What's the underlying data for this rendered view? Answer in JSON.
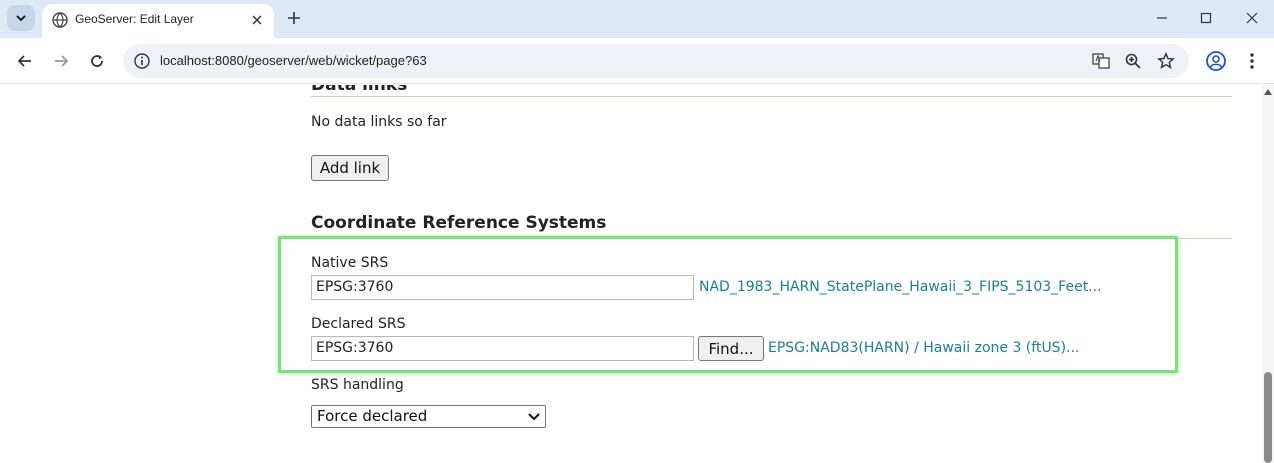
{
  "browser": {
    "tab_title": "GeoServer: Edit Layer",
    "url": "localhost:8080/geoserver/web/wicket/page?63"
  },
  "data_links": {
    "heading": "Data links",
    "empty_text": "No data links so far",
    "add_button": "Add link"
  },
  "crs": {
    "heading": "Coordinate Reference Systems",
    "native_label": "Native SRS",
    "native_value": "EPSG:3760",
    "native_link": "NAD_1983_HARN_StatePlane_Hawaii_3_FIPS_5103_Feet...",
    "declared_label": "Declared SRS",
    "declared_value": "EPSG:3760",
    "find_button": "Find...",
    "declared_link": "EPSG:NAD83(HARN) / Hawaii zone 3 (ftUS)...",
    "handling_label": "SRS handling",
    "handling_value": "Force declared"
  },
  "colors": {
    "highlight": "#7de07a",
    "link": "#1a7f9c",
    "tabbar": "#dee8f6"
  }
}
